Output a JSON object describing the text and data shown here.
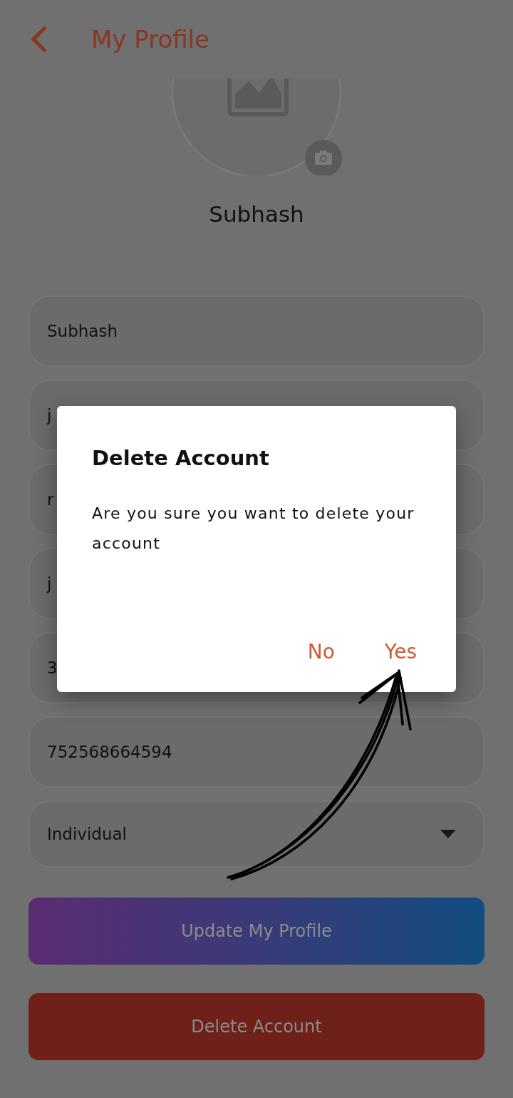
{
  "header": {
    "title": "My Profile"
  },
  "profile": {
    "name": "Subhash"
  },
  "fields": [
    {
      "kind": "text",
      "value": "Subhash"
    },
    {
      "kind": "text",
      "value": "j"
    },
    {
      "kind": "text",
      "value": "r"
    },
    {
      "kind": "text",
      "value": "j"
    },
    {
      "kind": "text",
      "value": "3"
    },
    {
      "kind": "text",
      "value": "752568664594"
    },
    {
      "kind": "dropdown",
      "value": "Individual"
    }
  ],
  "buttons": [
    {
      "kind": "update",
      "label": "Update My Profile"
    },
    {
      "kind": "delete",
      "label": "Delete Account"
    }
  ],
  "dialog": {
    "title": "Delete Account",
    "message": "Are you sure you want to delete your account",
    "actions": [
      "No",
      "Yes"
    ]
  }
}
